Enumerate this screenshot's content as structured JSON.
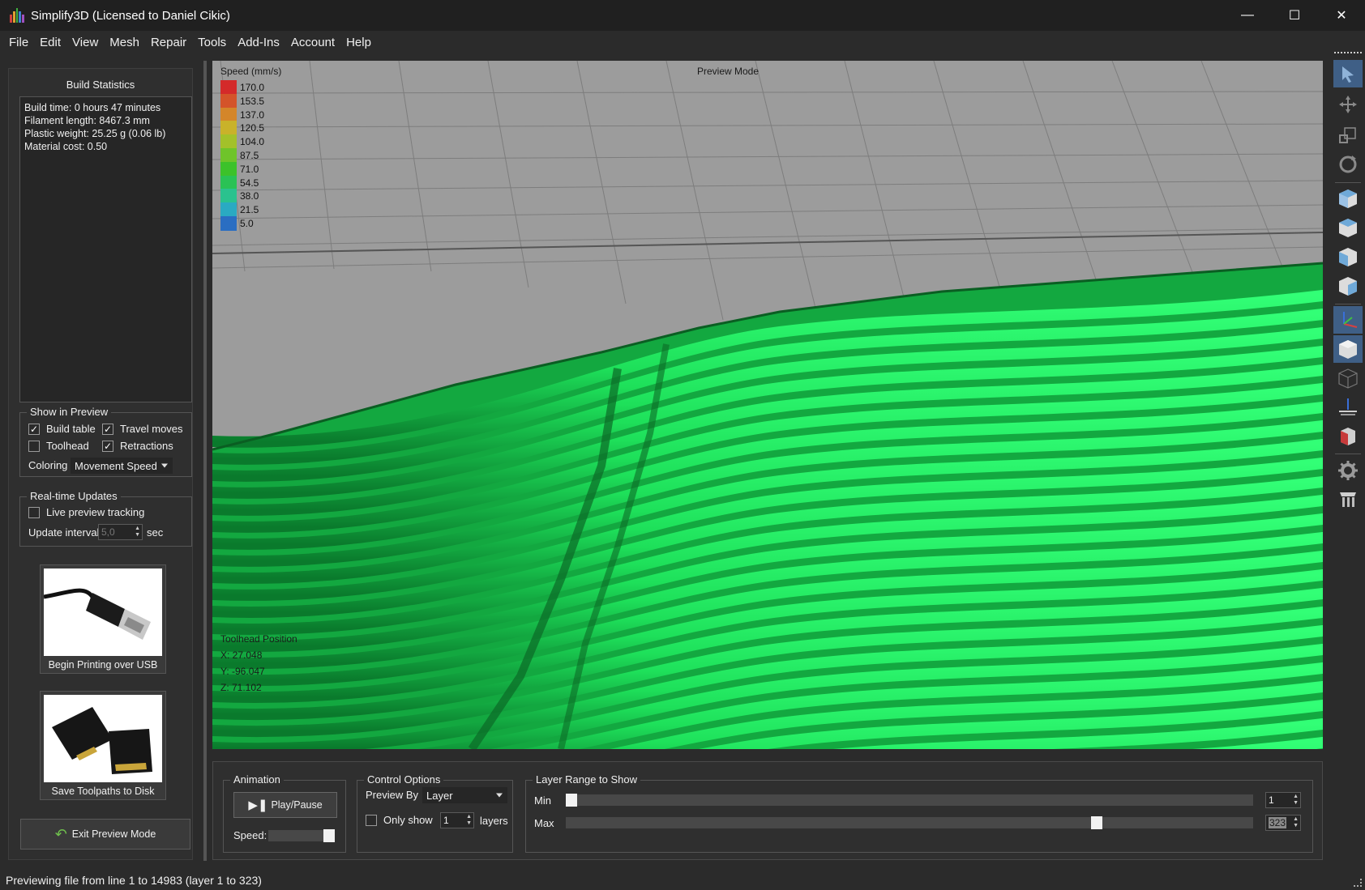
{
  "window": {
    "title": "Simplify3D (Licensed to Daniel Cikic)",
    "minimize": "—",
    "maximize": "☐",
    "close": "✕"
  },
  "menu": [
    "File",
    "Edit",
    "View",
    "Mesh",
    "Repair",
    "Tools",
    "Add-Ins",
    "Account",
    "Help"
  ],
  "build_statistics": {
    "title": "Build Statistics",
    "lines": [
      "Build time: 0 hours 47 minutes",
      "Filament length: 8467.3 mm",
      "Plastic weight: 25.25 g (0.06 lb)",
      "Material cost: 0.50"
    ]
  },
  "show_in_preview": {
    "title": "Show in Preview",
    "build_table": {
      "label": "Build table",
      "checked": true
    },
    "travel_moves": {
      "label": "Travel moves",
      "checked": true
    },
    "toolhead": {
      "label": "Toolhead",
      "checked": false
    },
    "retractions": {
      "label": "Retractions",
      "checked": true
    },
    "coloring_label": "Coloring",
    "coloring_value": "Movement Speed"
  },
  "realtime_updates": {
    "title": "Real-time Updates",
    "live_tracking": {
      "label": "Live preview tracking",
      "checked": false
    },
    "interval_label": "Update interval",
    "interval_value": "5,0",
    "interval_unit": "sec"
  },
  "buttons": {
    "usb": "Begin Printing over USB",
    "save": "Save Toolpaths to Disk",
    "exit": "Exit Preview Mode"
  },
  "viewport": {
    "mode_label": "Preview Mode",
    "legend_title": "Speed (mm/s)",
    "legend": [
      {
        "value": "170.0",
        "color": "#d42a2a"
      },
      {
        "value": "153.5",
        "color": "#d4542a"
      },
      {
        "value": "137.0",
        "color": "#d4862a"
      },
      {
        "value": "120.5",
        "color": "#c9b22a"
      },
      {
        "value": "104.0",
        "color": "#a3c12a"
      },
      {
        "value": "87.5",
        "color": "#6fc42a"
      },
      {
        "value": "71.0",
        "color": "#3cc22a"
      },
      {
        "value": "54.5",
        "color": "#2ac255"
      },
      {
        "value": "38.0",
        "color": "#2ac28e"
      },
      {
        "value": "21.5",
        "color": "#2aaac2"
      },
      {
        "value": "5.0",
        "color": "#2a6ec2"
      }
    ],
    "toolhead_position": {
      "title": "Toolhead Position",
      "x": "X: 27.048",
      "y": "Y: -96.047",
      "z": "Z: 71.102"
    },
    "extrusion_color": "#1ee05a"
  },
  "animation": {
    "title": "Animation",
    "play_label": "Play/Pause",
    "speed_label": "Speed:",
    "speed_value": 1.0
  },
  "control_options": {
    "title": "Control Options",
    "preview_by_label": "Preview By",
    "preview_by_value": "Layer",
    "only_show": {
      "label": "Only show",
      "checked": false
    },
    "only_show_value": "1",
    "layers_label": "layers"
  },
  "layer_range": {
    "title": "Layer Range to Show",
    "min_label": "Min",
    "max_label": "Max",
    "min_value": "1",
    "max_value": "323",
    "min_fraction": 0.0,
    "max_fraction": 0.777
  },
  "status": "Previewing file from line 1 to 14983 (layer 1 to 323)"
}
